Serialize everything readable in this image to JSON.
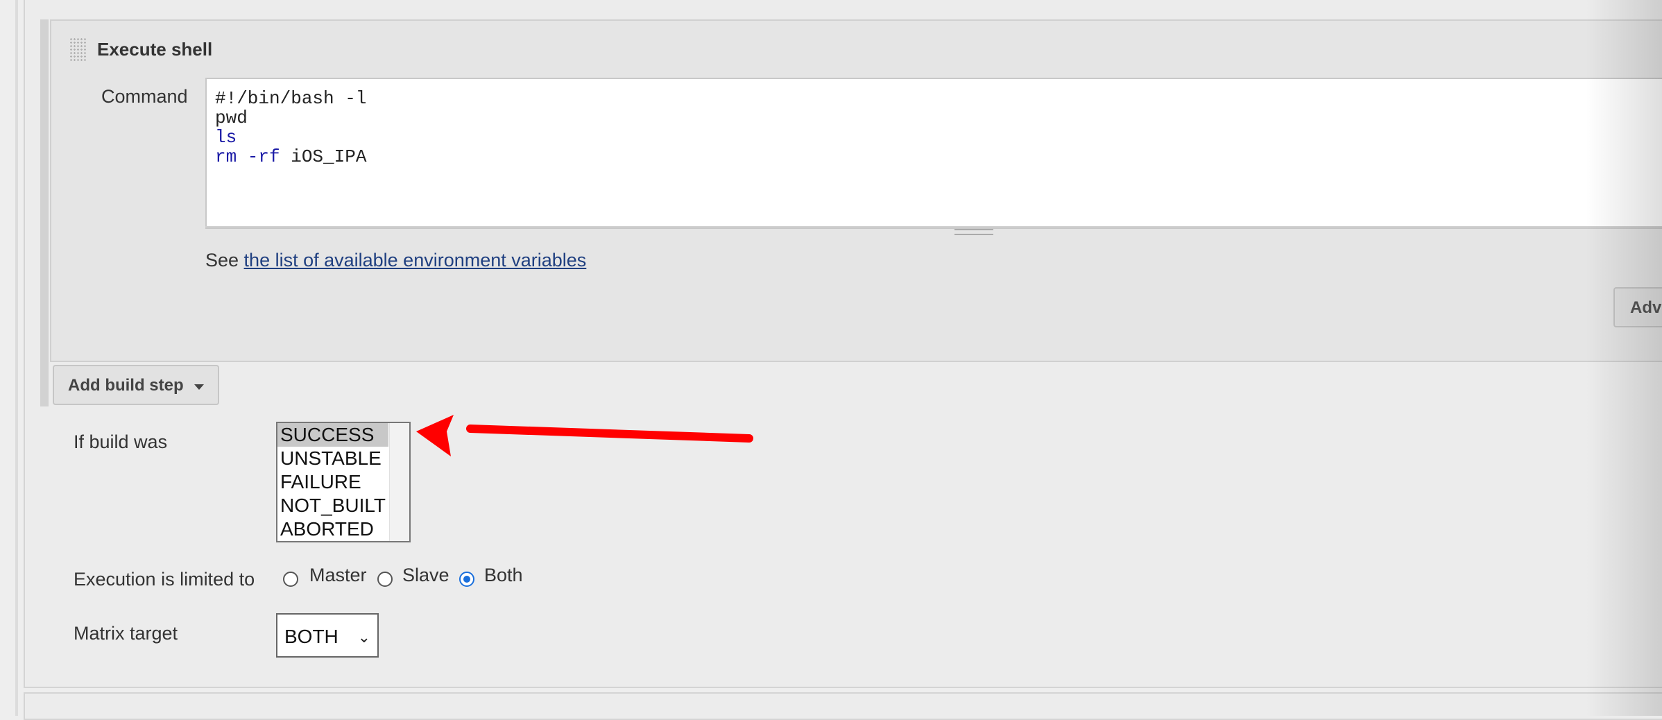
{
  "step": {
    "title": "Execute shell",
    "command_label": "Command",
    "command_lines": [
      "#!/bin/bash -l",
      "pwd",
      "ls",
      "rm -rf iOS_IPA"
    ],
    "env_prefix": "See ",
    "env_link": "the list of available environment variables",
    "advanced_label": "Adva"
  },
  "add_build_step": {
    "label": "Add build step"
  },
  "condition": {
    "label": "If build was",
    "options": [
      "SUCCESS",
      "UNSTABLE",
      "FAILURE",
      "NOT_BUILT",
      "ABORTED"
    ],
    "selected": "SUCCESS"
  },
  "execution": {
    "label": "Execution is limited to",
    "options": [
      "Master",
      "Slave",
      "Both"
    ],
    "selected": "Both"
  },
  "matrix": {
    "label": "Matrix target",
    "value": "BOTH"
  },
  "colors": {
    "arrow": "#ff0000",
    "link": "#1f3f80",
    "radio_selected": "#1a6fdc"
  }
}
